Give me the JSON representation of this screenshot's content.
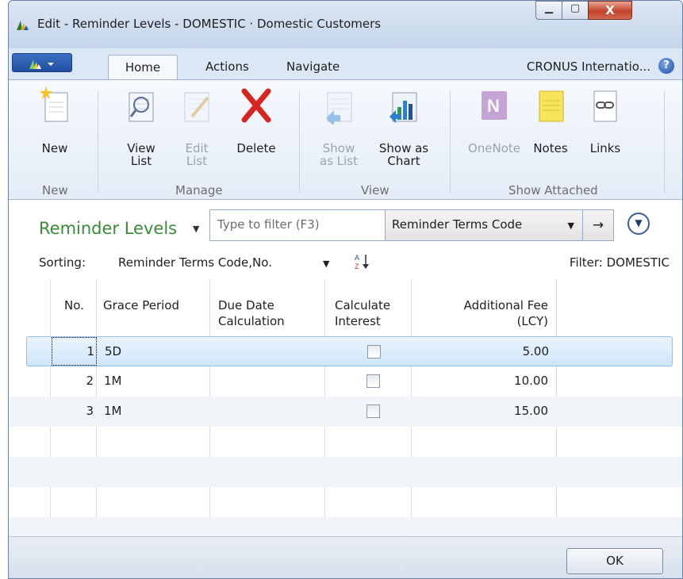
{
  "window": {
    "title": "Edit - Reminder Levels - DOMESTIC · Domestic Customers",
    "minimize_glyph": "▁",
    "maximize_glyph": "▢",
    "close_glyph": "X"
  },
  "ribbon": {
    "tabs": [
      "Home",
      "Actions",
      "Navigate"
    ],
    "company": "CRONUS Internatio...",
    "help_glyph": "?",
    "buttons": {
      "new": "New",
      "view_list": [
        "View",
        "List"
      ],
      "edit_list": [
        "Edit",
        "List"
      ],
      "delete": "Delete",
      "show_as_list": [
        "Show",
        "as List"
      ],
      "show_as_chart": [
        "Show as",
        "Chart"
      ],
      "onenote": "OneNote",
      "notes": "Notes",
      "links": "Links"
    },
    "groups": [
      "New",
      "Manage",
      "View",
      "Show Attached"
    ]
  },
  "page": {
    "title": "Reminder Levels",
    "filter_placeholder": "Type to filter (F3)",
    "filter_field": "Reminder Terms Code",
    "sorting_label": "Sorting:",
    "sorting_value": "Reminder Terms Code,No.",
    "filter_info": "Filter: DOMESTIC"
  },
  "table": {
    "headers": {
      "no": "No.",
      "grace_period": "Grace Period",
      "due_date_1": "Due Date",
      "due_date_2": "Calculation",
      "calc_interest_1": "Calculate",
      "calc_interest_2": "Interest",
      "fee_1": "Additional Fee",
      "fee_2": "(LCY)"
    },
    "rows": [
      {
        "no": "1",
        "grace_period": "5D",
        "due_date_calculation": "",
        "calculate_interest": false,
        "additional_fee": "5.00"
      },
      {
        "no": "2",
        "grace_period": "1M",
        "due_date_calculation": "",
        "calculate_interest": false,
        "additional_fee": "10.00"
      },
      {
        "no": "3",
        "grace_period": "1M",
        "due_date_calculation": "",
        "calculate_interest": false,
        "additional_fee": "15.00"
      }
    ]
  },
  "footer": {
    "ok_label": "OK"
  }
}
